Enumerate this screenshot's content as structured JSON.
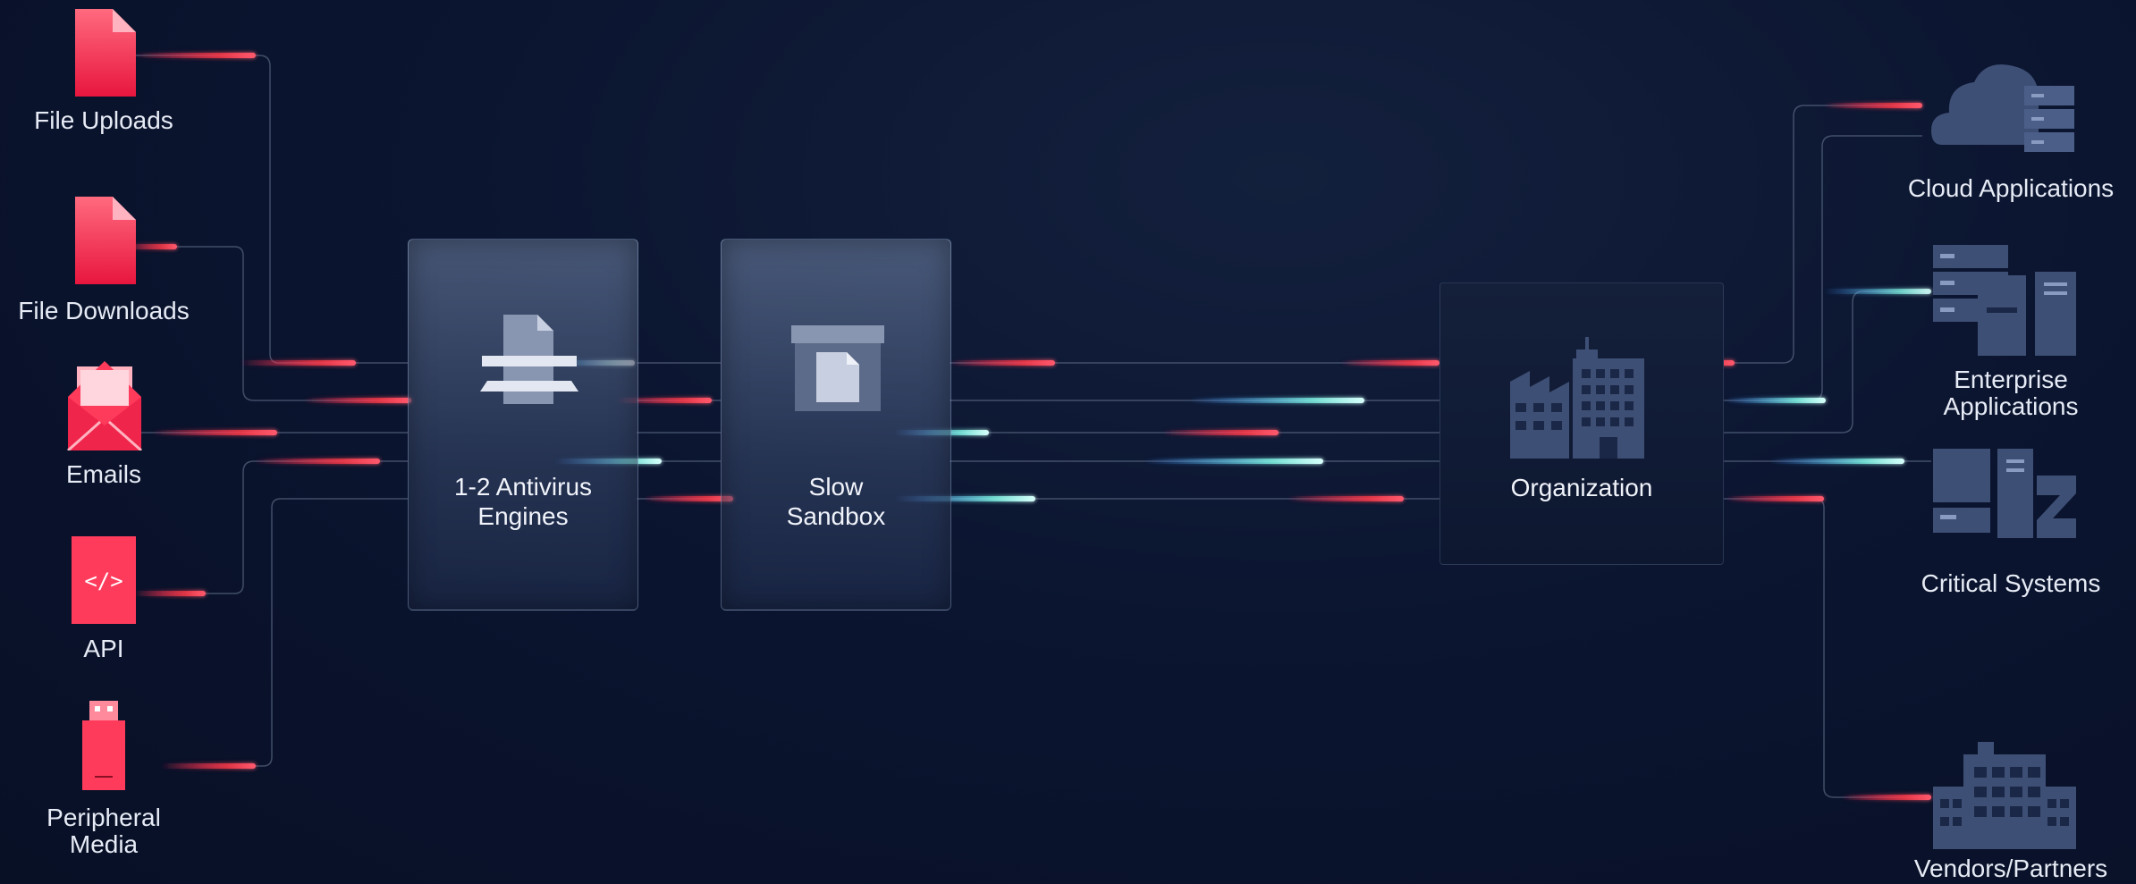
{
  "sources": [
    {
      "id": "file-uploads",
      "label": "File Uploads",
      "icon": "document-icon"
    },
    {
      "id": "file-downloads",
      "label": "File Downloads",
      "icon": "document-icon"
    },
    {
      "id": "emails",
      "label": "Emails",
      "icon": "envelope-icon"
    },
    {
      "id": "api",
      "label": "API",
      "icon": "code-icon"
    },
    {
      "id": "peripheral-media",
      "label_line1": "Peripheral",
      "label_line2": "Media",
      "icon": "usb-drive-icon"
    }
  ],
  "stages": {
    "antivirus": {
      "line1": "1-2 Antivirus",
      "line2": "Engines",
      "icon": "scanner-icon"
    },
    "sandbox": {
      "line1": "Slow",
      "line2": "Sandbox",
      "icon": "archive-box-icon"
    }
  },
  "organization": {
    "label": "Organization",
    "icon": "buildings-icon"
  },
  "destinations": [
    {
      "id": "cloud-applications",
      "label": "Cloud Applications",
      "icon": "cloud-server-icon"
    },
    {
      "id": "enterprise-applications",
      "label_line1": "Enterprise",
      "label_line2": "Applications",
      "icon": "servers-icon"
    },
    {
      "id": "critical-systems",
      "label": "Critical Systems",
      "icon": "systems-icon"
    },
    {
      "id": "vendors-partners",
      "label": "Vendors/Partners",
      "icon": "office-building-icon"
    }
  ],
  "colors": {
    "threat": "#ff2d55",
    "clean": "#7ff5e6",
    "wire": "#7c8aa6",
    "icon_red": "#ff3b5c",
    "icon_slate": "#3e4f75"
  }
}
